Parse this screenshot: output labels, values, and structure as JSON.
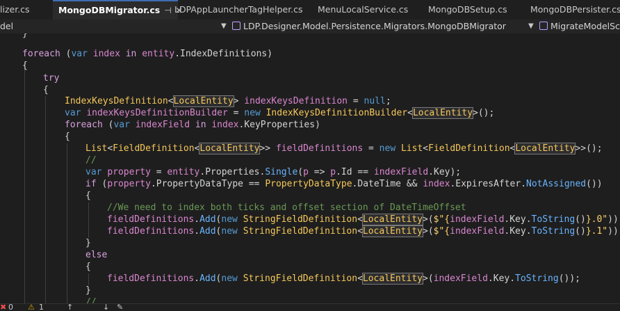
{
  "tabs": [
    {
      "label": "lizer.cs"
    },
    {
      "label": "MongoDBMigrator.cs",
      "pin": "⊣",
      "close": "✕"
    },
    {
      "label": "LDPAppLauncherTagHelper.cs"
    },
    {
      "label": "MenuLocalService.cs"
    },
    {
      "label": "MongoDBSetup.cs"
    },
    {
      "label": "MongoDBPersister.cs"
    }
  ],
  "navbar": {
    "project": "del",
    "type": "LDP.Designer.Model.Persistence.Migrators.MongoDBMigrator",
    "member": "MigrateModelSche"
  },
  "code": {
    "l1": {
      "kw": "foreach",
      "a": " (",
      "var": "var",
      "b": " ",
      "name": "index",
      "c": " ",
      "in": "in",
      "d": " ",
      "obj": "entity",
      "e": ".",
      "prop": "IndexDefinitions",
      "f": ")"
    },
    "l2": "{",
    "l3": "try",
    "l4": "{",
    "l5": {
      "type": "IndexKeysDefinition",
      "lt": "<",
      "arg": "LocalEntity",
      "gt": ">",
      "sp": " ",
      "name": "indexKeysDefinition",
      "eq": " = ",
      "nul": "null",
      "end": ";"
    },
    "l6": {
      "var": "var",
      "sp": " ",
      "name": "indexKeysDefinitionBuilder",
      "eq": " = ",
      "new": "new",
      "sp2": " ",
      "type": "IndexKeysDefinitionBuilder",
      "lt": "<",
      "arg": "LocalEntity",
      "gt": ">",
      "end": "();"
    },
    "l7": {
      "kw": "foreach",
      "a": " (",
      "var": "var",
      "b": " ",
      "name": "indexField",
      "c": " ",
      "in": "in",
      "d": " ",
      "obj": "index",
      "e": ".",
      "prop": "KeyProperties",
      "f": ")"
    },
    "l8": "{",
    "l9": {
      "t1": "List",
      "lt1": "<",
      "t2": "FieldDefinition",
      "lt2": "<",
      "arg": "LocalEntity",
      "gt": ">>",
      "sp": " ",
      "name": "fieldDefinitions",
      "eq": " = ",
      "new": "new",
      "sp2": " ",
      "t3": "List",
      "lt3": "<",
      "t4": "FieldDefinition",
      "lt4": "<",
      "arg2": "LocalEntity",
      "end": ">>();"
    },
    "l10": "//",
    "l11": {
      "var": "var",
      "sp": " ",
      "name": "property",
      "eq": " = ",
      "obj": "entity",
      "dot": ".",
      "prop": "Properties",
      "dot2": ".",
      "method": "Single",
      "a": "(",
      "p": "p",
      "arrow": " => ",
      "p2": "p",
      "dot3": ".",
      "id": "Id",
      "eqeq": " == ",
      "obj2": "indexField",
      "dot4": ".",
      "key": "Key",
      "end": ");"
    },
    "l12": {
      "kw": "if",
      "a": " (",
      "obj": "property",
      "dot": ".",
      "prop": "PropertyDataType",
      "eq": " == ",
      "type": "PropertyDataType",
      "dot2": ".",
      "val": "DateTime",
      "and": " && ",
      "obj2": "index",
      "dot3": ".",
      "prop2": "ExpiresAfter",
      "dot4": ".",
      "method": "NotAssigned",
      "end": "())"
    },
    "l13": "{",
    "l14": "//We need to index both ticks and offset section of DateTimeOffset",
    "l15": {
      "name": "fieldDefinitions",
      "dot": ".",
      "method": "Add",
      "a": "(",
      "new": "new",
      "sp": " ",
      "type": "StringFieldDefinition",
      "lt": "<",
      "arg": "LocalEntity",
      "gt": ">",
      "b": "(",
      "s1": "$\"{",
      "obj": "indexField",
      "dot2": ".",
      "key": "Key",
      "dot3": ".",
      "m2": "ToString",
      "c": "()",
      "s2": "}.0\"",
      "end": "));"
    },
    "l16": {
      "name": "fieldDefinitions",
      "dot": ".",
      "method": "Add",
      "a": "(",
      "new": "new",
      "sp": " ",
      "type": "StringFieldDefinition",
      "lt": "<",
      "arg": "LocalEntity",
      "gt": ">",
      "b": "(",
      "s1": "$\"{",
      "obj": "indexField",
      "dot2": ".",
      "key": "Key",
      "dot3": ".",
      "m2": "ToString",
      "c": "()",
      "s2": "}.1\"",
      "end": "));"
    },
    "l17": "}",
    "l18": "else",
    "l19": "{",
    "l20": {
      "name": "fieldDefinitions",
      "dot": ".",
      "method": "Add",
      "a": "(",
      "new": "new",
      "sp": " ",
      "type": "StringFieldDefinition",
      "lt": "<",
      "arg": "LocalEntity",
      "gt": ">",
      "b": "(",
      "obj": "indexField",
      "dot2": ".",
      "key": "Key",
      "dot3": ".",
      "m2": "ToString",
      "end": "());"
    },
    "l21": "}",
    "l22": "//"
  },
  "status": {
    "errors": "0",
    "warnings": "1"
  },
  "colors": {
    "keyword": "#569cd6",
    "control": "#d8a0df",
    "type": "#f5c85a",
    "local": "#d986cf",
    "method": "#69b4ff",
    "string": "#ffd36b",
    "comment": "#6a9955"
  }
}
